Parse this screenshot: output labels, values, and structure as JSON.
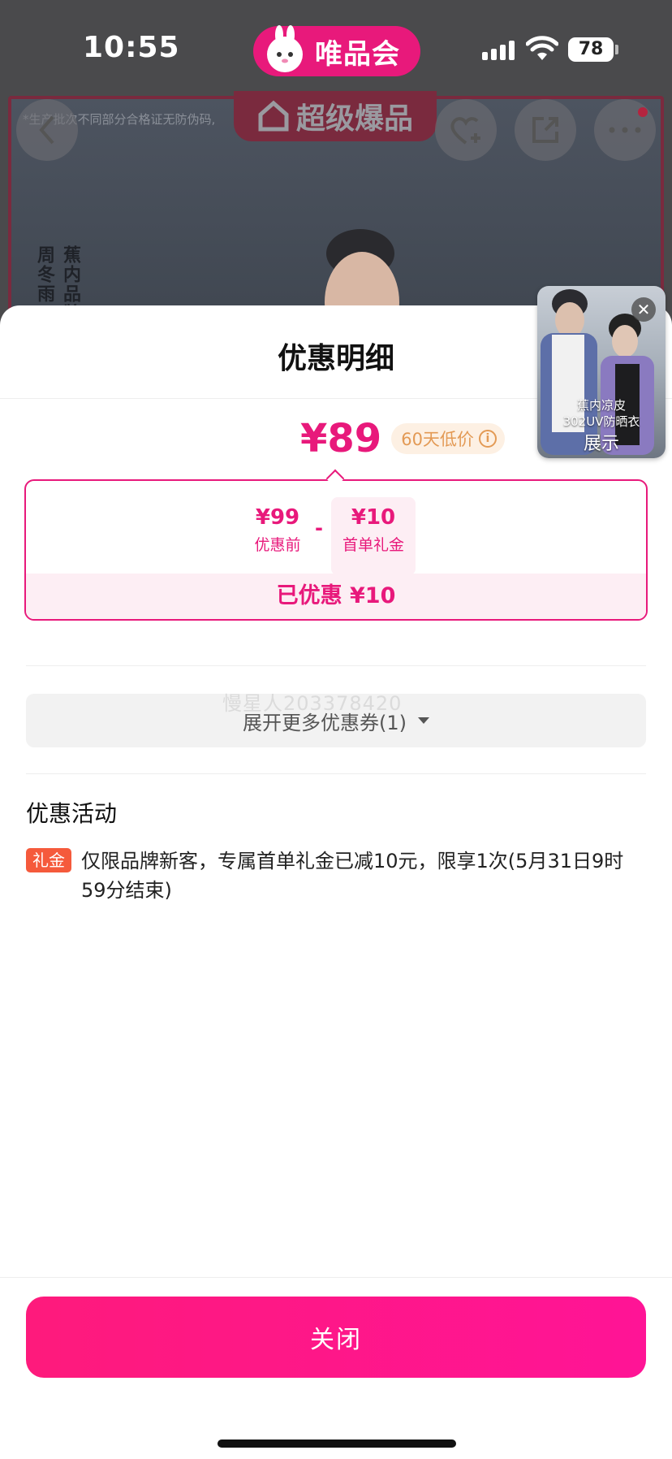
{
  "status_bar": {
    "time": "10:55",
    "app_name": "唯品会",
    "battery": "78"
  },
  "background": {
    "notice": "*生产批次不同部分合格证无防伪码,",
    "banner": "超级爆品",
    "vertical_text_1": "周冬雨",
    "vertical_text_2": "蕉内品牌"
  },
  "sheet": {
    "title": "优惠明细",
    "final_price": "¥89",
    "low_price_badge": "60天低价",
    "calc": {
      "original_price": "¥99",
      "original_label": "优惠前",
      "minus": "-",
      "gift_value": "¥10",
      "gift_label": "首单礼金",
      "saved_text": "已优惠 ¥10"
    },
    "watermark": "慢星人203378420",
    "expand_label": "展开更多优惠券(1)",
    "section_title": "优惠活动",
    "promo": {
      "tag": "礼金",
      "text": "仅限品牌新客，专属首单礼金已减10元，限享1次(5月31日9时59分结束)"
    },
    "close_label": "关闭"
  },
  "float_video": {
    "caption_line1": "蕉内凉皮",
    "caption_line2": "302UV防晒衣",
    "caption_line3": "展示"
  },
  "colors": {
    "brand": "#e8197b",
    "button": "#fe1a7c",
    "tag": "#f55a3c"
  }
}
